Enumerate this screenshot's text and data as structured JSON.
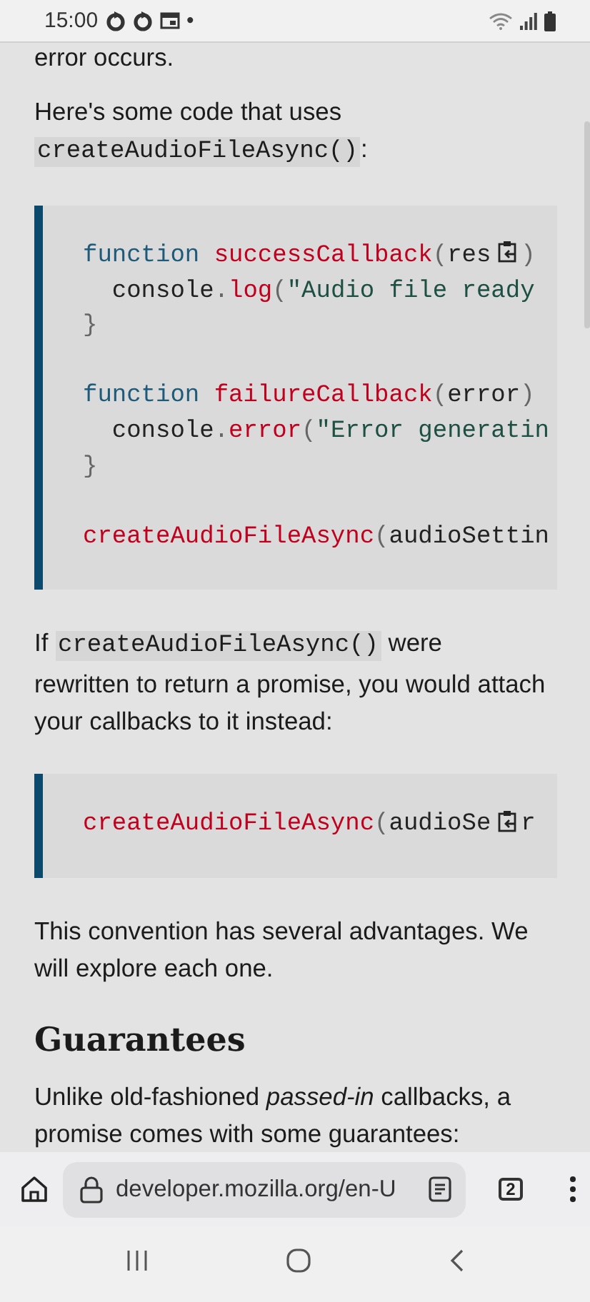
{
  "status_bar": {
    "time": "15:00",
    "dot": "•"
  },
  "article": [
    {
      "kind": "paragraph",
      "lines": [
        [
          {
            "kind": "text",
            "text": "error occurs."
          }
        ]
      ]
    },
    {
      "kind": "paragraph",
      "lines": [
        [
          {
            "kind": "text",
            "text": "Here's some code that uses"
          }
        ],
        [
          {
            "kind": "code",
            "text": "createAudioFileAsync()"
          },
          {
            "kind": "text",
            "text": ":"
          }
        ]
      ]
    },
    {
      "kind": "code_block",
      "lines": [
        {
          "kind": "code",
          "tokens": [
            {
              "kind": "keyword",
              "t": "function"
            },
            {
              "kind": "fn",
              "t": " successCallback"
            },
            {
              "kind": "punct",
              "t": "("
            },
            {
              "kind": "plain",
              "t": "res"
            },
            {
              "kind": "copy"
            },
            {
              "kind": "punct",
              "t": ")"
            }
          ]
        },
        {
          "kind": "code",
          "tokens": [
            {
              "kind": "plain",
              "t": "  console"
            },
            {
              "kind": "punct",
              "t": "."
            },
            {
              "kind": "fn",
              "t": "log"
            },
            {
              "kind": "punct",
              "t": "("
            },
            {
              "kind": "string",
              "t": "\"Audio file ready"
            }
          ]
        },
        {
          "kind": "code",
          "tokens": [
            {
              "kind": "punct",
              "t": "}"
            }
          ]
        },
        {
          "kind": "blank"
        },
        {
          "kind": "code",
          "tokens": [
            {
              "kind": "keyword",
              "t": "function"
            },
            {
              "kind": "fn",
              "t": " failureCallback"
            },
            {
              "kind": "punct",
              "t": "("
            },
            {
              "kind": "plain",
              "t": "error"
            },
            {
              "kind": "punct",
              "t": ")"
            }
          ]
        },
        {
          "kind": "code",
          "tokens": [
            {
              "kind": "plain",
              "t": "  console"
            },
            {
              "kind": "punct",
              "t": "."
            },
            {
              "kind": "fn",
              "t": "error"
            },
            {
              "kind": "punct",
              "t": "("
            },
            {
              "kind": "string",
              "t": "\"Error generatin"
            }
          ]
        },
        {
          "kind": "code",
          "tokens": [
            {
              "kind": "punct",
              "t": "}"
            }
          ]
        },
        {
          "kind": "blank"
        },
        {
          "kind": "code",
          "tokens": [
            {
              "kind": "fn",
              "t": "createAudioFileAsync"
            },
            {
              "kind": "punct",
              "t": "("
            },
            {
              "kind": "plain",
              "t": "audioSettin"
            }
          ]
        }
      ]
    },
    {
      "kind": "paragraph",
      "lines": [
        [
          {
            "kind": "text",
            "text": "If "
          },
          {
            "kind": "code",
            "text": "createAudioFileAsync()"
          },
          {
            "kind": "text",
            "text": " were"
          }
        ],
        [
          {
            "kind": "text",
            "text": "rewritten to return a promise, you would attach"
          }
        ],
        [
          {
            "kind": "text",
            "text": "your callbacks to it instead:"
          }
        ]
      ]
    },
    {
      "kind": "code_block",
      "lines": [
        {
          "kind": "code",
          "tokens": [
            {
              "kind": "fn",
              "t": "createAudioFileAsync"
            },
            {
              "kind": "punct",
              "t": "("
            },
            {
              "kind": "plain",
              "t": "audioSe"
            },
            {
              "kind": "copy"
            },
            {
              "kind": "plain",
              "t": "r"
            }
          ]
        }
      ]
    },
    {
      "kind": "paragraph",
      "lines": [
        [
          {
            "kind": "text",
            "text": "This convention has several advantages. We"
          }
        ],
        [
          {
            "kind": "text",
            "text": "will explore each one."
          }
        ]
      ]
    },
    {
      "kind": "heading",
      "text": "Guarantees"
    },
    {
      "kind": "paragraph",
      "lines": [
        [
          {
            "kind": "text",
            "text": "Unlike old-fashioned *passed-in* callbacks, a"
          }
        ],
        [
          {
            "kind": "text",
            "text": "promise comes with some guarantees:"
          }
        ]
      ]
    }
  ],
  "browser_bar": {
    "url": "developer.mozilla.org/en-U",
    "tab_count": "2"
  }
}
